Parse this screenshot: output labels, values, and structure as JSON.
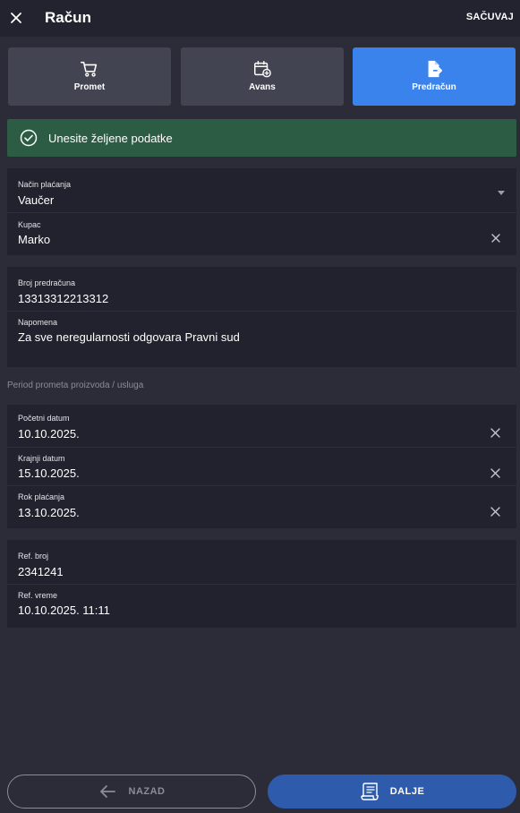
{
  "topbar": {
    "title": "Račun",
    "save_label": "SAČUVAJ",
    "close_icon": "close-icon"
  },
  "tabs": [
    {
      "label": "Promet",
      "icon": "cart-icon",
      "active": false
    },
    {
      "label": "Avans",
      "icon": "calendar-plus-icon",
      "active": false
    },
    {
      "label": "Predračun",
      "icon": "document-arrow-icon",
      "active": true
    }
  ],
  "alert": {
    "text": "Unesite željene podatke",
    "icon": "check-circle-icon",
    "color": "#2d5c44"
  },
  "payment": {
    "method_label": "Način plaćanja",
    "method_value": "Vaučer",
    "customer_label": "Kupac",
    "customer_value": "Marko"
  },
  "invoice": {
    "number_label": "Broj predračuna",
    "number_value": "13313312213312",
    "note_label": "Napomena",
    "note_value": "Za sve neregularnosti odgovara Pravni sud"
  },
  "period": {
    "section_title": "Period prometa proizvoda / usluga",
    "start_label": "Početni datum",
    "start_value": "10.10.2025.",
    "end_label": "Krajnji datum",
    "end_value": "15.10.2025.",
    "due_label": "Rok plaćanja",
    "due_value": "13.10.2025."
  },
  "reference": {
    "ref_number_label": "Ref. broj",
    "ref_number_value": "2341241",
    "ref_time_label": "Ref. vreme",
    "ref_time_value": "10.10.2025. 11:11"
  },
  "footer": {
    "back_label": "NAZAD",
    "next_label": "DALJE"
  },
  "colors": {
    "background": "#2b2c37",
    "card": "#21222d",
    "accent": "#3a82ec",
    "next_button": "#2e5bab",
    "success": "#2d5c44"
  }
}
